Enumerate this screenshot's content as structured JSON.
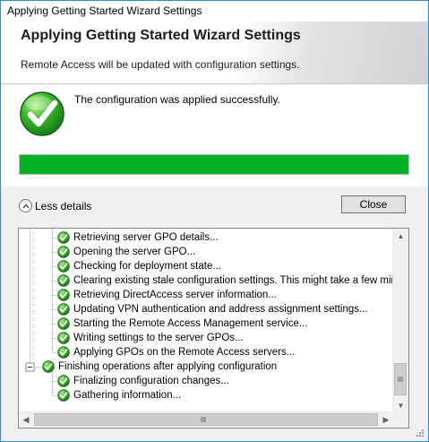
{
  "window": {
    "title": "Applying Getting Started Wizard Settings"
  },
  "header": {
    "title": "Applying Getting Started Wizard Settings",
    "subtitle": "Remote Access will be updated with configuration settings."
  },
  "status": {
    "message": "The configuration was applied successfully.",
    "progress_percent": 100,
    "progress_color": "#06b025"
  },
  "details": {
    "toggle_label": "Less details",
    "close_label": "Close",
    "items": [
      {
        "text": "Retrieving server GPO details...",
        "level": 2,
        "status": "success"
      },
      {
        "text": "Opening the server GPO...",
        "level": 2,
        "status": "success"
      },
      {
        "text": "Checking for deployment state...",
        "level": 2,
        "status": "success"
      },
      {
        "text": "Clearing existing stale configuration settings. This might take a few minutes.",
        "level": 2,
        "status": "success"
      },
      {
        "text": "Retrieving DirectAccess server information...",
        "level": 2,
        "status": "success"
      },
      {
        "text": "Updating VPN authentication and address assignment settings...",
        "level": 2,
        "status": "success"
      },
      {
        "text": "Starting the Remote Access Management service...",
        "level": 2,
        "status": "success"
      },
      {
        "text": "Writing settings to the server GPOs...",
        "level": 2,
        "status": "success"
      },
      {
        "text": "Applying GPOs on the Remote Access servers...",
        "level": 2,
        "status": "success"
      },
      {
        "text": "Finishing operations after applying configuration",
        "level": 1,
        "status": "success",
        "expanded": true
      },
      {
        "text": "Finalizing configuration changes...",
        "level": 2,
        "status": "success"
      },
      {
        "text": "Gathering information...",
        "level": 2,
        "status": "success"
      }
    ]
  },
  "icons": {
    "success": "check-circle-icon",
    "collapse": "chevron-up-icon"
  }
}
